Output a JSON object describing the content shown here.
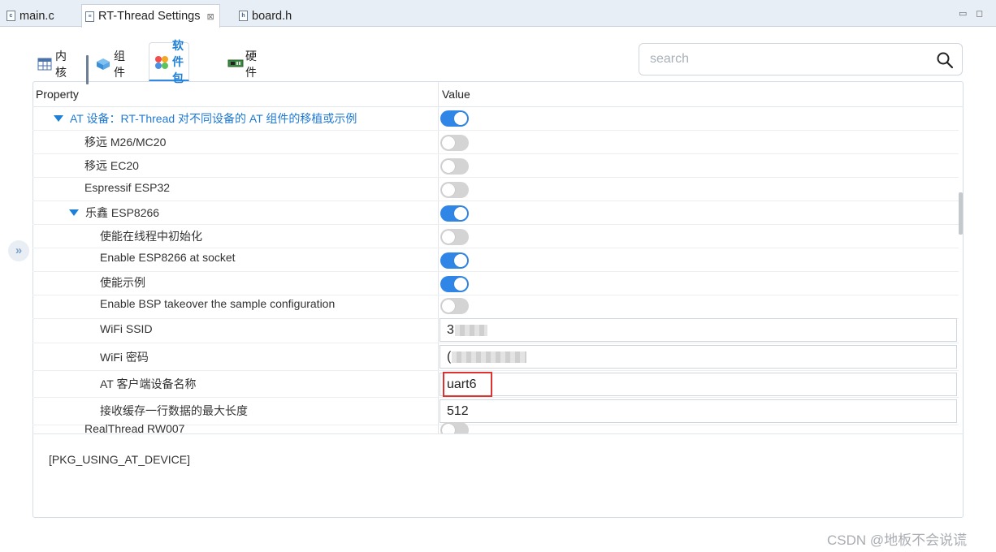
{
  "editor_tabs": [
    {
      "label": "main.c",
      "icon": "c-file-icon"
    },
    {
      "label": "RT-Thread Settings",
      "icon": "settings-file-icon",
      "close": "⊠"
    },
    {
      "label": "board.h",
      "icon": "h-file-icon"
    }
  ],
  "window_controls": {
    "minimize": "▭",
    "maximize": "◻"
  },
  "category_tabs": [
    {
      "label": "内核",
      "icon": "kernel-table-icon"
    },
    {
      "label": "组件",
      "icon": "component-cube-icon"
    },
    {
      "label": "软件包",
      "icon": "package-dots-icon",
      "active": true
    },
    {
      "label": "硬件",
      "icon": "hardware-board-icon"
    }
  ],
  "search": {
    "placeholder": "search",
    "value": ""
  },
  "table": {
    "header_property": "Property",
    "header_value": "Value",
    "rows": [
      {
        "label": "AT 设备：RT-Thread 对不同设备的 AT 组件的移植或示例",
        "type": "toggle",
        "on": true,
        "group": true
      },
      {
        "label": "移远 M26/MC20",
        "type": "toggle",
        "on": false
      },
      {
        "label": "移远 EC20",
        "type": "toggle",
        "on": false
      },
      {
        "label": "Espressif ESP32",
        "type": "toggle",
        "on": false
      },
      {
        "label": "乐鑫 ESP8266",
        "type": "toggle",
        "on": true,
        "expanded": true
      },
      {
        "label": "使能在线程中初始化",
        "type": "toggle",
        "on": false
      },
      {
        "label": "Enable ESP8266 at socket",
        "type": "toggle",
        "on": true
      },
      {
        "label": "使能示例",
        "type": "toggle",
        "on": true
      },
      {
        "label": "Enable BSP takeover the sample configuration",
        "type": "toggle",
        "on": false
      },
      {
        "label": "WiFi SSID",
        "type": "text",
        "value": "3"
      },
      {
        "label": "WiFi 密码",
        "type": "text",
        "value": "("
      },
      {
        "label": "AT 客户端设备名称",
        "type": "text",
        "value": "uart6",
        "highlighted": true
      },
      {
        "label": "接收缓存一行数据的最大长度",
        "type": "text",
        "value": "512"
      },
      {
        "label": "RealThread RW007",
        "type": "toggle",
        "on": false
      }
    ]
  },
  "description": "[PKG_USING_AT_DEVICE]",
  "collapse_handle": "»",
  "watermark": "CSDN @地板不会说谎",
  "colors": {
    "accent": "#2f86e6",
    "toggle_off": "#d4d4d4",
    "highlight": "#e03131"
  }
}
